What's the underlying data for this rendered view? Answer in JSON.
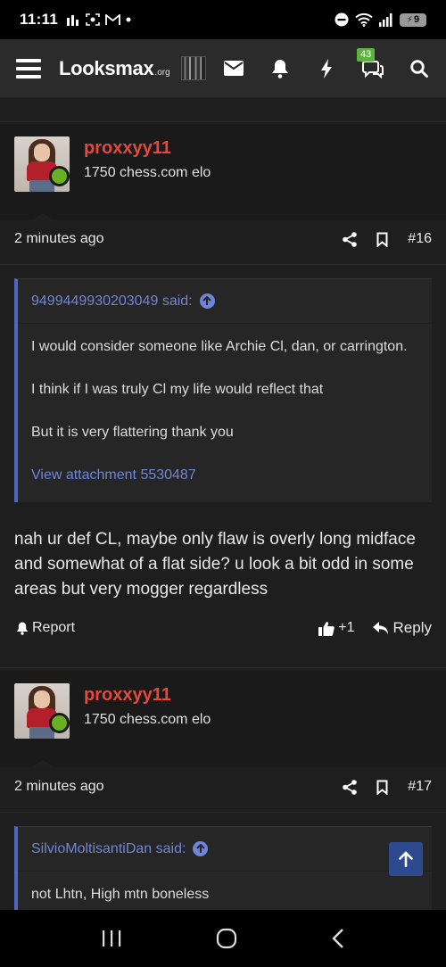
{
  "status_bar": {
    "time": "11:11",
    "battery": "9"
  },
  "site": {
    "logo": "Looksmax",
    "logo_suffix": ".org",
    "alerts_badge": "43"
  },
  "posts": [
    {
      "user": {
        "name": "proxxyy11",
        "title": "1750 chess.com elo"
      },
      "time": "2 minutes ago",
      "number": "#16",
      "quote": {
        "author": "9499449930203049 said:",
        "lines": [
          "I would consider someone like Archie Cl, dan, or carrington.",
          "I think if I was truly Cl my life would reflect that",
          "But it is very flattering thank you"
        ],
        "attachment": "View attachment 5530487"
      },
      "body": "nah ur def CL, maybe only flaw is overly long midface and somewhat of a flat side? u look a bit odd in some areas but very mogger regardless",
      "actions": {
        "report": "Report",
        "likes": "+1",
        "reply": "Reply"
      }
    },
    {
      "user": {
        "name": "proxxyy11",
        "title": "1750 chess.com elo"
      },
      "time": "2 minutes ago",
      "number": "#17",
      "quote": {
        "author": "SilvioMoltisantiDan said:",
        "lines": [
          "not Lhtn, High mtn boneless"
        ]
      }
    }
  ],
  "colors": {
    "accent_link": "#6f86d6",
    "username": "#e5483d",
    "online": "#6ab023",
    "quote_bar": "#4f66c2"
  }
}
